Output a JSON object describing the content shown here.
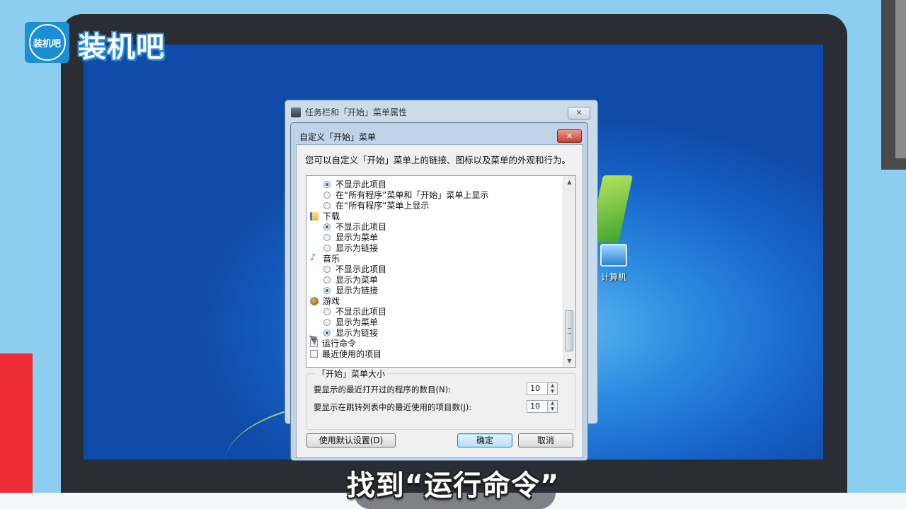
{
  "brand": {
    "logo_badge": "装机吧",
    "logo_text": "装机吧"
  },
  "desktop": {
    "computer_icon_label": "计算机"
  },
  "outer_window": {
    "title": "任务栏和「开始」菜单属性",
    "close_symbol": "✕"
  },
  "dialog": {
    "title": "自定义「开始」菜单",
    "close_symbol": "✕",
    "description": "您可以自定义「开始」菜单上的链接、图标以及菜单的外观和行为。",
    "list_rows": [
      {
        "kind": "option",
        "label": "不显示此项目",
        "selected": true
      },
      {
        "kind": "option",
        "label": "在“所有程序”菜单和「开始」菜单上显示",
        "selected": false
      },
      {
        "kind": "option",
        "label": "在“所有程序”菜单上显示",
        "selected": false
      },
      {
        "kind": "category",
        "label": "下载",
        "icon": "download-folder-icon"
      },
      {
        "kind": "option",
        "label": "不显示此项目",
        "selected": true
      },
      {
        "kind": "option",
        "label": "显示为菜单",
        "selected": false
      },
      {
        "kind": "option",
        "label": "显示为链接",
        "selected": false
      },
      {
        "kind": "category",
        "label": "音乐",
        "icon": "music-icon"
      },
      {
        "kind": "option",
        "label": "不显示此项目",
        "selected": false
      },
      {
        "kind": "option",
        "label": "显示为菜单",
        "selected": false
      },
      {
        "kind": "option",
        "label": "显示为链接",
        "selected": true
      },
      {
        "kind": "category",
        "label": "游戏",
        "icon": "games-icon"
      },
      {
        "kind": "option",
        "label": "不显示此项目",
        "selected": false
      },
      {
        "kind": "option",
        "label": "显示为菜单",
        "selected": false
      },
      {
        "kind": "option",
        "label": "显示为链接",
        "selected": true
      },
      {
        "kind": "checkbox",
        "label": "运行命令",
        "checked": false
      },
      {
        "kind": "checkbox",
        "label": "最近使用的项目",
        "checked": false
      }
    ],
    "size_group": {
      "legend": "「开始」菜单大小",
      "recent_programs_label": "要显示的最近打开过的程序的数目(N):",
      "recent_programs_value": "10",
      "jumplist_label": "要显示在跳转列表中的最近使用的项目数(J):",
      "jumplist_value": "10"
    },
    "buttons": {
      "defaults": "使用默认设置(D)",
      "ok": "确定",
      "cancel": "取消"
    }
  },
  "caption": "找到“运行命令”"
}
